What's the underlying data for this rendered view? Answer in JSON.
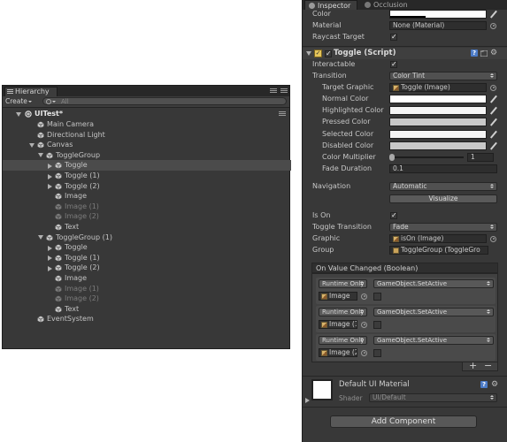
{
  "hierarchy": {
    "tab_label": "Hierarchy",
    "create_label": "Create",
    "search_placeholder": "All",
    "scene_name": "UITest*",
    "items": [
      {
        "label": "Main Camera",
        "depth": 1,
        "arrow": "none",
        "dim": false,
        "selected": false
      },
      {
        "label": "Directional Light",
        "depth": 1,
        "arrow": "none",
        "dim": false,
        "selected": false
      },
      {
        "label": "Canvas",
        "depth": 1,
        "arrow": "down",
        "dim": false,
        "selected": false
      },
      {
        "label": "ToggleGroup",
        "depth": 2,
        "arrow": "down",
        "dim": false,
        "selected": false
      },
      {
        "label": "Toggle",
        "depth": 3,
        "arrow": "right",
        "dim": false,
        "selected": true
      },
      {
        "label": "Toggle (1)",
        "depth": 3,
        "arrow": "right",
        "dim": false,
        "selected": false
      },
      {
        "label": "Toggle (2)",
        "depth": 3,
        "arrow": "right",
        "dim": false,
        "selected": false
      },
      {
        "label": "Image",
        "depth": 3,
        "arrow": "none",
        "dim": false,
        "selected": false
      },
      {
        "label": "Image (1)",
        "depth": 3,
        "arrow": "none",
        "dim": true,
        "selected": false
      },
      {
        "label": "Image (2)",
        "depth": 3,
        "arrow": "none",
        "dim": true,
        "selected": false
      },
      {
        "label": "Text",
        "depth": 3,
        "arrow": "none",
        "dim": false,
        "selected": false
      },
      {
        "label": "ToggleGroup (1)",
        "depth": 2,
        "arrow": "down",
        "dim": false,
        "selected": false
      },
      {
        "label": "Toggle",
        "depth": 3,
        "arrow": "right",
        "dim": false,
        "selected": false
      },
      {
        "label": "Toggle (1)",
        "depth": 3,
        "arrow": "right",
        "dim": false,
        "selected": false
      },
      {
        "label": "Toggle (2)",
        "depth": 3,
        "arrow": "right",
        "dim": false,
        "selected": false
      },
      {
        "label": "Image",
        "depth": 3,
        "arrow": "none",
        "dim": false,
        "selected": false
      },
      {
        "label": "Image (1)",
        "depth": 3,
        "arrow": "none",
        "dim": true,
        "selected": false
      },
      {
        "label": "Image (2)",
        "depth": 3,
        "arrow": "none",
        "dim": true,
        "selected": false
      },
      {
        "label": "Text",
        "depth": 3,
        "arrow": "none",
        "dim": false,
        "selected": false
      },
      {
        "label": "EventSystem",
        "depth": 1,
        "arrow": "none",
        "dim": false,
        "selected": false
      }
    ]
  },
  "inspector": {
    "tabs": [
      {
        "label": "Inspector",
        "active": true
      },
      {
        "label": "Occlusion",
        "active": false
      }
    ],
    "image_component": {
      "color_label": "Color",
      "material_label": "Material",
      "material_value": "None (Material)",
      "raycast_label": "Raycast Target",
      "raycast_checked": true
    },
    "toggle_component": {
      "title": "Toggle (Script)",
      "interactable_label": "Interactable",
      "interactable_checked": true,
      "transition_label": "Transition",
      "transition_value": "Color Tint",
      "target_graphic_label": "Target Graphic",
      "target_graphic_value": "Toggle (Image)",
      "colors": [
        {
          "label": "Normal Color",
          "color": "#ffffff"
        },
        {
          "label": "Highlighted Color",
          "color": "#f5f5f5"
        },
        {
          "label": "Pressed Color",
          "color": "#c8c8c8"
        },
        {
          "label": "Selected Color",
          "color": "#f5f5f5"
        },
        {
          "label": "Disabled Color",
          "color": "#c8c8c8"
        }
      ],
      "color_multiplier_label": "Color Multiplier",
      "color_multiplier_value": "1",
      "fade_duration_label": "Fade Duration",
      "fade_duration_value": "0.1",
      "navigation_label": "Navigation",
      "navigation_value": "Automatic",
      "visualize_label": "Visualize",
      "is_on_label": "Is On",
      "is_on_checked": true,
      "toggle_transition_label": "Toggle Transition",
      "toggle_transition_value": "Fade",
      "graphic_label": "Graphic",
      "graphic_value": "isOn (Image)",
      "group_label": "Group",
      "group_value": "ToggleGroup (ToggleGro",
      "event_title": "On Value Changed (Boolean)",
      "entries": [
        {
          "mode": "Runtime Only",
          "function": "GameObject.SetActive",
          "object": "Image"
        },
        {
          "mode": "Runtime Only",
          "function": "GameObject.SetActive",
          "object": "Image (1"
        },
        {
          "mode": "Runtime Only",
          "function": "GameObject.SetActive",
          "object": "Image (2"
        }
      ],
      "plus": "+",
      "minus": "−"
    },
    "material": {
      "name": "Default UI Material",
      "shader_label": "Shader",
      "shader_value": "UI/Default"
    },
    "add_component_label": "Add Component",
    "help_icon_glyph": "?"
  }
}
